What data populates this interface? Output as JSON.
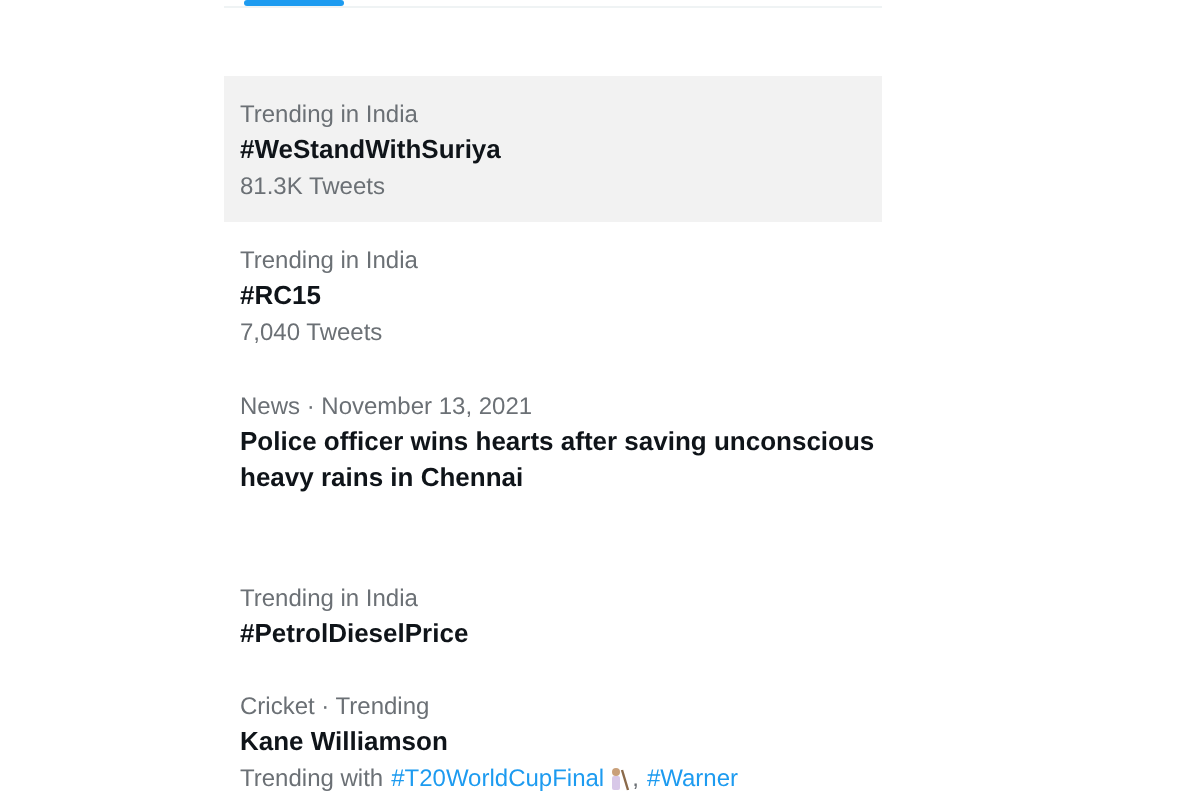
{
  "trends": [
    {
      "kind": "trend",
      "highlighted": true,
      "context": "Trending in India",
      "title": "#WeStandWithSuriya",
      "count": "81.3K Tweets"
    },
    {
      "kind": "trend",
      "highlighted": false,
      "context": "Trending in India",
      "title": "#RC15",
      "count": "7,040 Tweets"
    },
    {
      "kind": "news",
      "highlighted": false,
      "context": "News · November 13, 2021",
      "title": "Police officer wins hearts after saving unconscious",
      "title_line_2": "heavy rains in Chennai"
    },
    {
      "kind": "trend",
      "highlighted": false,
      "context": "Trending in India",
      "title": "#PetrolDieselPrice"
    },
    {
      "kind": "trend",
      "highlighted": false,
      "context": "Cricket · Trending",
      "title": "Kane Williamson",
      "trending_with": {
        "label": "Trending with",
        "separator": ",",
        "hashtags": [
          "#T20WorldCupFinal",
          "#Warner"
        ]
      }
    }
  ]
}
